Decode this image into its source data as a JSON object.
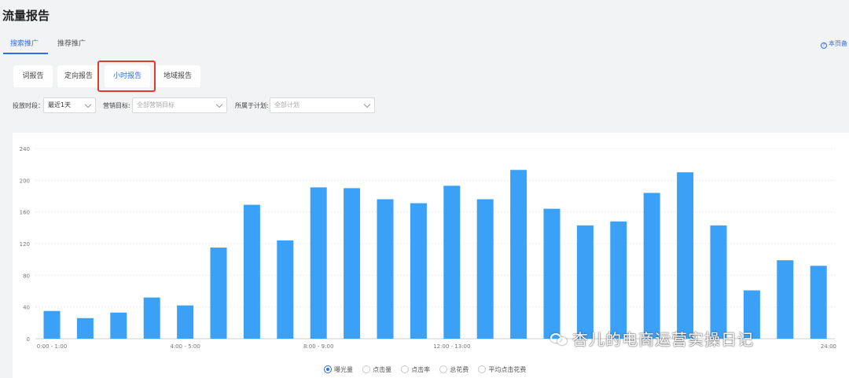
{
  "page": {
    "title": "流量报告"
  },
  "tabs": [
    {
      "label": "搜索推广",
      "active": true
    },
    {
      "label": "推荐推广",
      "active": false
    }
  ],
  "help": {
    "label": "本页备"
  },
  "subtabs": [
    {
      "label": "词报告",
      "active": false
    },
    {
      "label": "定向报告",
      "active": false
    },
    {
      "label": "小时报告",
      "active": true
    },
    {
      "label": "地域报告",
      "active": false
    }
  ],
  "filters": [
    {
      "label": "投放时段：",
      "value": "最近1天",
      "placeholder": false
    },
    {
      "label": "营销目标:",
      "value": "全部营销目标",
      "placeholder": true
    },
    {
      "label": "所属于计划:",
      "value": "全部计划",
      "placeholder": true
    }
  ],
  "legend": [
    {
      "label": "曝光量",
      "selected": true
    },
    {
      "label": "点击量",
      "selected": false
    },
    {
      "label": "点击率",
      "selected": false
    },
    {
      "label": "总花费",
      "selected": false
    },
    {
      "label": "平均点击花费",
      "selected": false
    }
  ],
  "watermark": {
    "text": "杏儿的电商运营实操日记"
  },
  "colors": {
    "bar": "#3aa1f6",
    "accent": "#2f6ee8",
    "highlight": "#e23a32"
  },
  "chart_data": {
    "type": "bar",
    "categories": [
      "0:00 - 1:00",
      "1:00 - 2:00",
      "2:00 - 3:00",
      "3:00 - 4:00",
      "4:00 - 5:00",
      "5:00 - 6:00",
      "6:00 - 7:00",
      "7:00 - 8:00",
      "8:00 - 9:00",
      "9:00 - 10:00",
      "10:00 - 11:00",
      "11:00 - 12:00",
      "12:00 - 13:00",
      "13:00 - 14:00",
      "14:00 - 15:00",
      "15:00 - 16:00",
      "16:00 - 17:00",
      "17:00 - 18:00",
      "18:00 - 19:00",
      "19:00 - 20:00",
      "20:00 - 21:00",
      "21:00 - 22:00",
      "22:00 - 23:00",
      "23:00 - 24:00"
    ],
    "values": [
      35,
      26,
      33,
      52,
      42,
      115,
      169,
      124,
      191,
      190,
      176,
      171,
      193,
      176,
      213,
      164,
      143,
      148,
      184,
      210,
      143,
      61,
      99,
      92
    ],
    "visible_tick_labels": [
      {
        "index": 0,
        "label": "0:00 - 1:00"
      },
      {
        "index": 4,
        "label": "4:00 - 5:00"
      },
      {
        "index": 8,
        "label": "8:00 - 9:00"
      },
      {
        "index": 12,
        "label": "12:00 - 13:00"
      },
      {
        "index": 23,
        "label": "24:00"
      }
    ],
    "yticks": [
      0,
      40,
      80,
      120,
      160,
      200,
      240
    ],
    "ylim": [
      0,
      240
    ],
    "grid": true
  }
}
